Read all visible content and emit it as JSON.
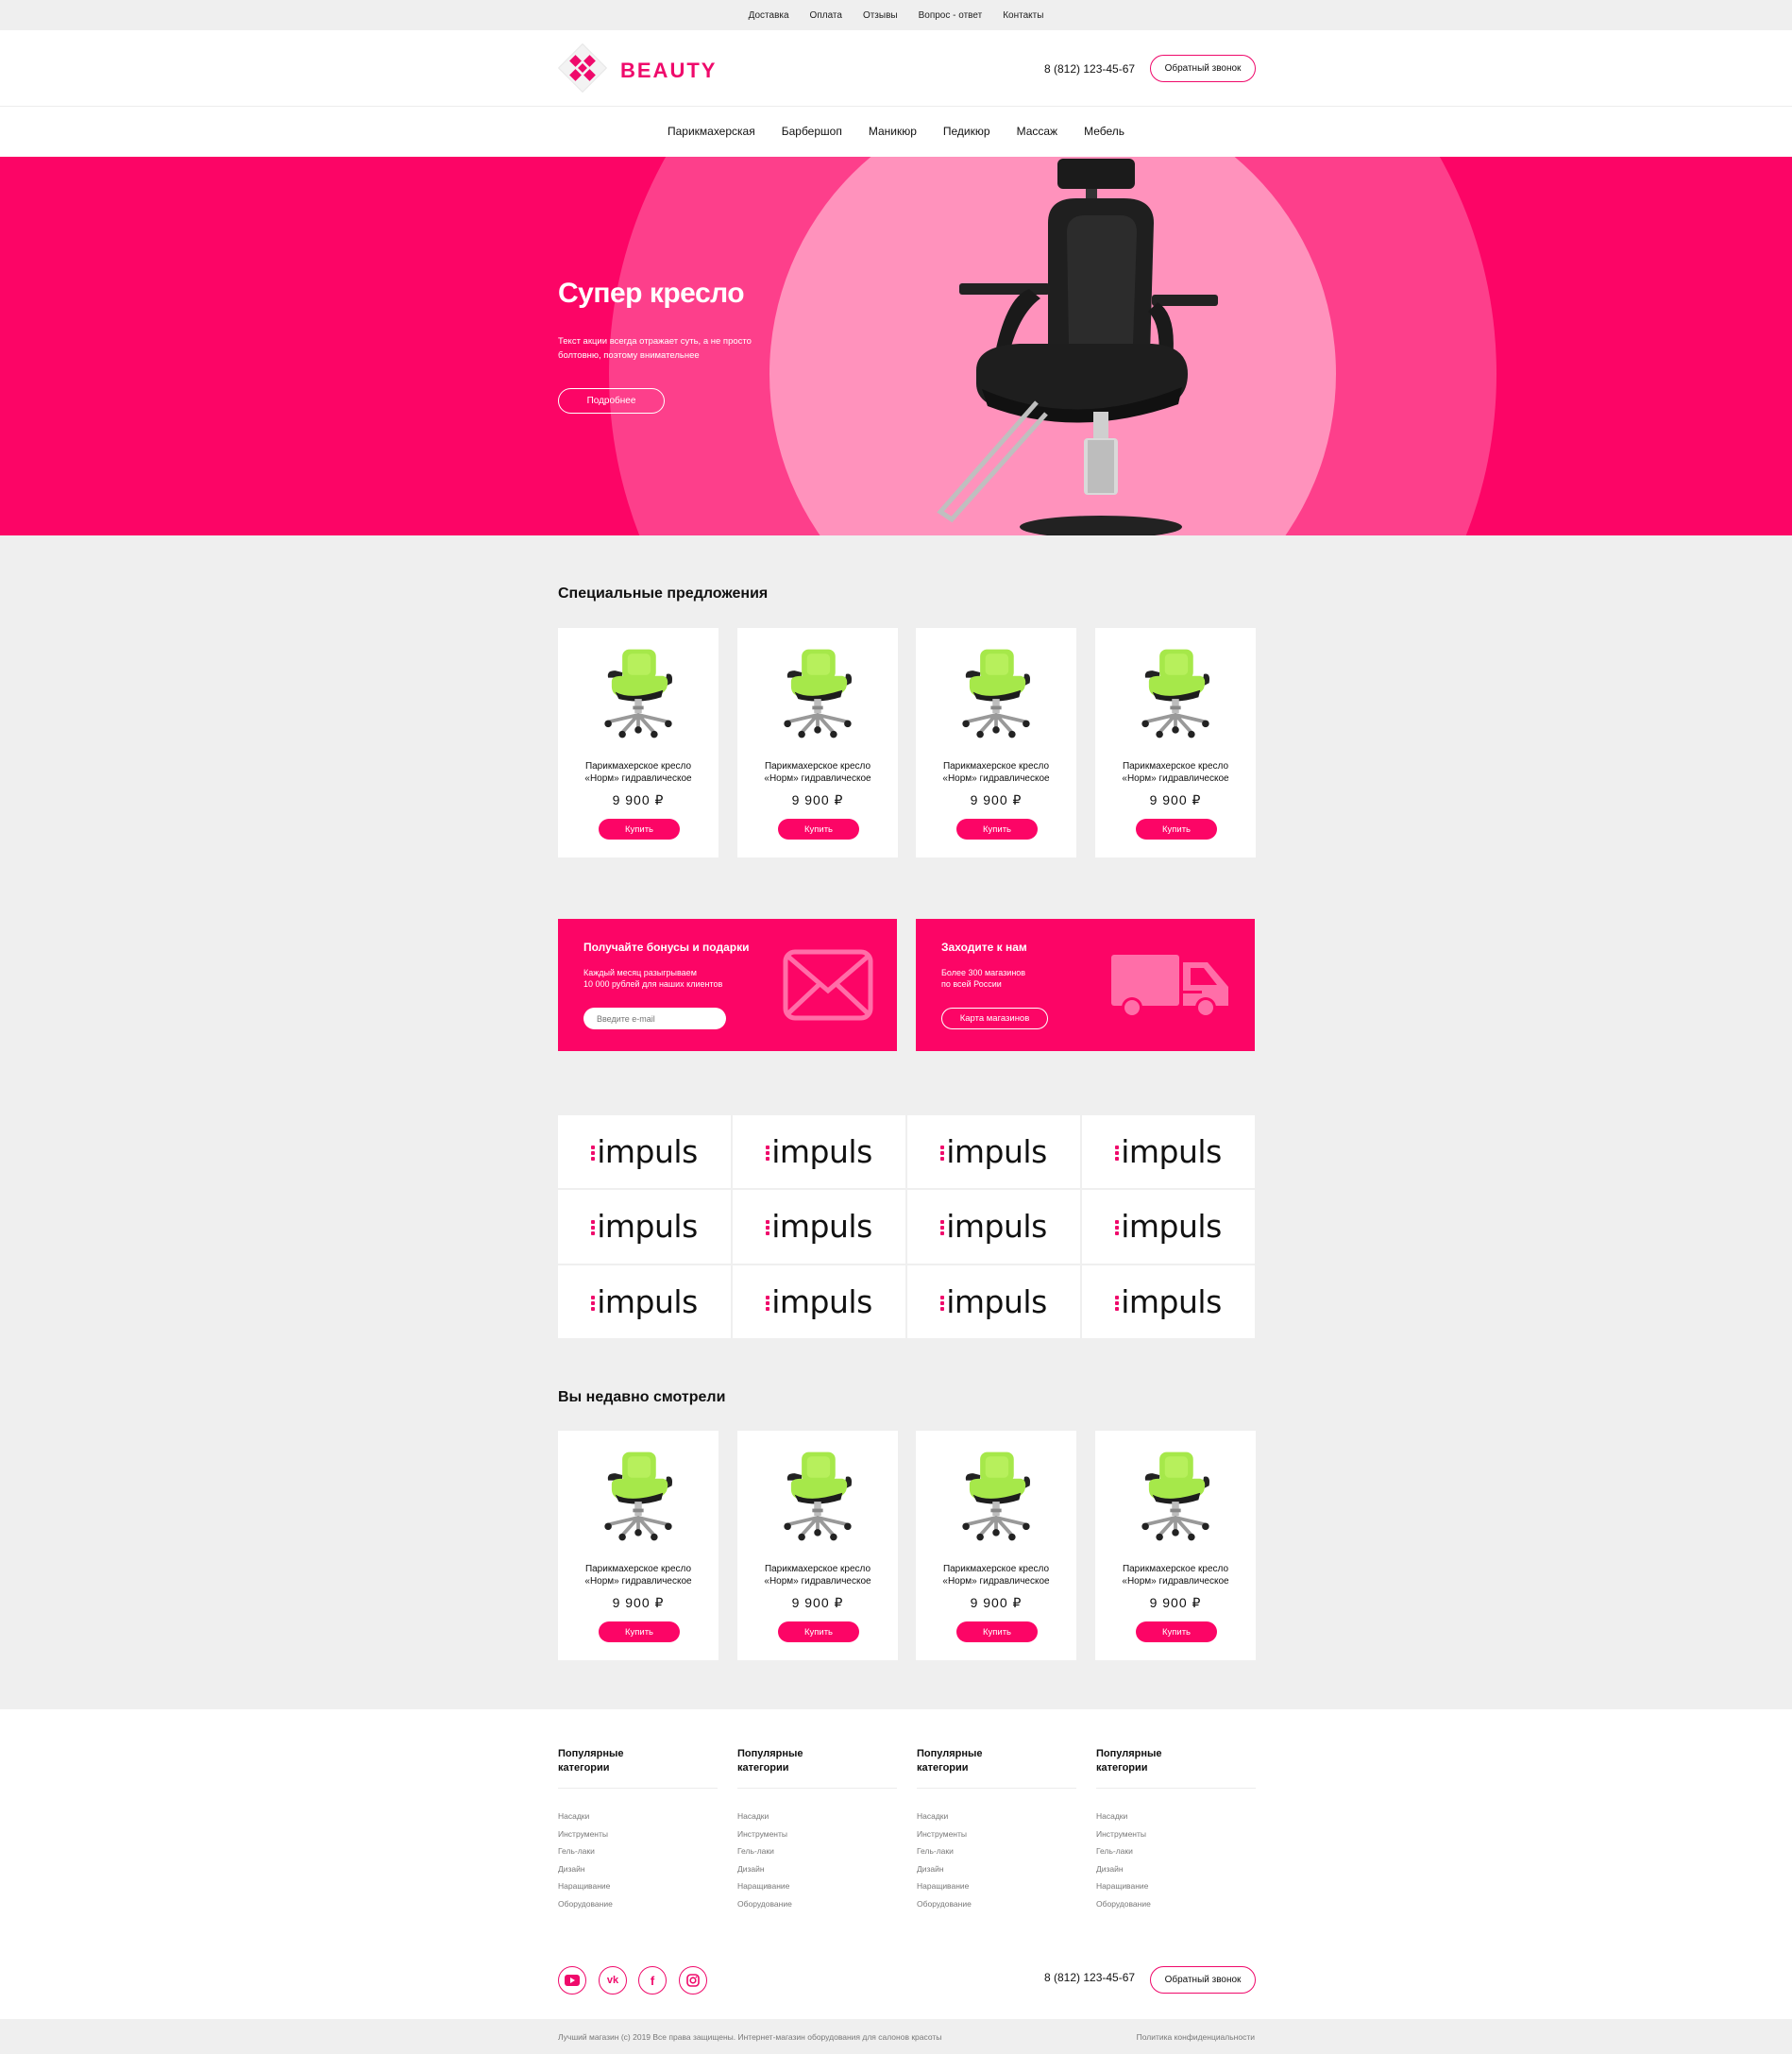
{
  "topbar": {
    "links": [
      "Доставка",
      "Оплата",
      "Отзывы",
      "Вопрос - ответ",
      "Контакты"
    ]
  },
  "header": {
    "logo_text": "BEAUTY",
    "phone": "8 (812) 123-45-67",
    "callback_label": "Обратный звонок"
  },
  "nav": {
    "items": [
      "Парикмахерская",
      "Барбершоп",
      "Маникюр",
      "Педикюр",
      "Массаж",
      "Мебель"
    ]
  },
  "hero": {
    "title": "Супер кресло",
    "text": "Текст акции всегда отражает суть, а не просто болтовню, поэтому внимательнее",
    "button_label": "Подробнее"
  },
  "special": {
    "title": "Специальные предложения",
    "products": [
      {
        "name_line1": "Парикмахерское кресло",
        "name_line2": "«Норм» гидравлическое",
        "price": "9 900 ₽",
        "buy_label": "Купить"
      },
      {
        "name_line1": "Парикмахерское кресло",
        "name_line2": "«Норм» гидравлическое",
        "price": "9 900 ₽",
        "buy_label": "Купить"
      },
      {
        "name_line1": "Парикмахерское кресло",
        "name_line2": "«Норм» гидравлическое",
        "price": "9 900 ₽",
        "buy_label": "Купить"
      },
      {
        "name_line1": "Парикмахерское кресло",
        "name_line2": "«Норм» гидравлическое",
        "price": "9 900 ₽",
        "buy_label": "Купить"
      }
    ]
  },
  "promos": {
    "bonus": {
      "title": "Получайте бонусы и подарки",
      "text_line1": "Каждый месяц разыгрываем",
      "text_line2": "10 000 рублей для наших клиентов",
      "input_placeholder": "Введите e-mail",
      "icon": "envelope-icon"
    },
    "stores": {
      "title": "Заходите к нам",
      "text_line1": "Более 300 магазинов",
      "text_line2": "по всей России",
      "button_label": "Карта магазинов",
      "icon": "truck-icon"
    }
  },
  "brands": {
    "items": [
      "impuls",
      "impuls",
      "impuls",
      "impuls",
      "impuls",
      "impuls",
      "impuls",
      "impuls",
      "impuls",
      "impuls",
      "impuls",
      "impuls"
    ]
  },
  "recent": {
    "title": "Вы недавно смотрели",
    "products": [
      {
        "name_line1": "Парикмахерское кресло",
        "name_line2": "«Норм» гидравлическое",
        "price": "9 900 ₽",
        "buy_label": "Купить"
      },
      {
        "name_line1": "Парикмахерское кресло",
        "name_line2": "«Норм» гидравлическое",
        "price": "9 900 ₽",
        "buy_label": "Купить"
      },
      {
        "name_line1": "Парикмахерское кресло",
        "name_line2": "«Норм» гидравлическое",
        "price": "9 900 ₽",
        "buy_label": "Купить"
      },
      {
        "name_line1": "Парикмахерское кресло",
        "name_line2": "«Норм» гидравлическое",
        "price": "9 900 ₽",
        "buy_label": "Купить"
      }
    ]
  },
  "footer": {
    "columns": [
      {
        "title_line1": "Популярные",
        "title_line2": "категории",
        "links": [
          "Насадки",
          "Инструменты",
          "Гель-лаки",
          "Дизайн",
          "Наращивание",
          "Оборудование"
        ]
      },
      {
        "title_line1": "Популярные",
        "title_line2": "категории",
        "links": [
          "Насадки",
          "Инструменты",
          "Гель-лаки",
          "Дизайн",
          "Наращивание",
          "Оборудование"
        ]
      },
      {
        "title_line1": "Популярные",
        "title_line2": "категории",
        "links": [
          "Насадки",
          "Инструменты",
          "Гель-лаки",
          "Дизайн",
          "Наращивание",
          "Оборудование"
        ]
      },
      {
        "title_line1": "Популярные",
        "title_line2": "категории",
        "links": [
          "Насадки",
          "Инструменты",
          "Гель-лаки",
          "Дизайн",
          "Наращивание",
          "Оборудование"
        ]
      }
    ],
    "social": [
      "youtube-icon",
      "vk-icon",
      "facebook-icon",
      "instagram-icon"
    ],
    "social_vk_label": "vk",
    "social_fb_label": "f",
    "phone": "8 (812) 123-45-67",
    "callback_label": "Обратный звонок",
    "copyright": "Лучший магазин (c) 2019 Все права защищены. Интернет-магазин оборудования для салонов красоты",
    "policy": "Политика конфиденциальности"
  },
  "colors": {
    "accent": "#fc0566",
    "brand_text": "#ef0a6b",
    "product_chair": "#a6e84a",
    "background": "#efefef"
  }
}
